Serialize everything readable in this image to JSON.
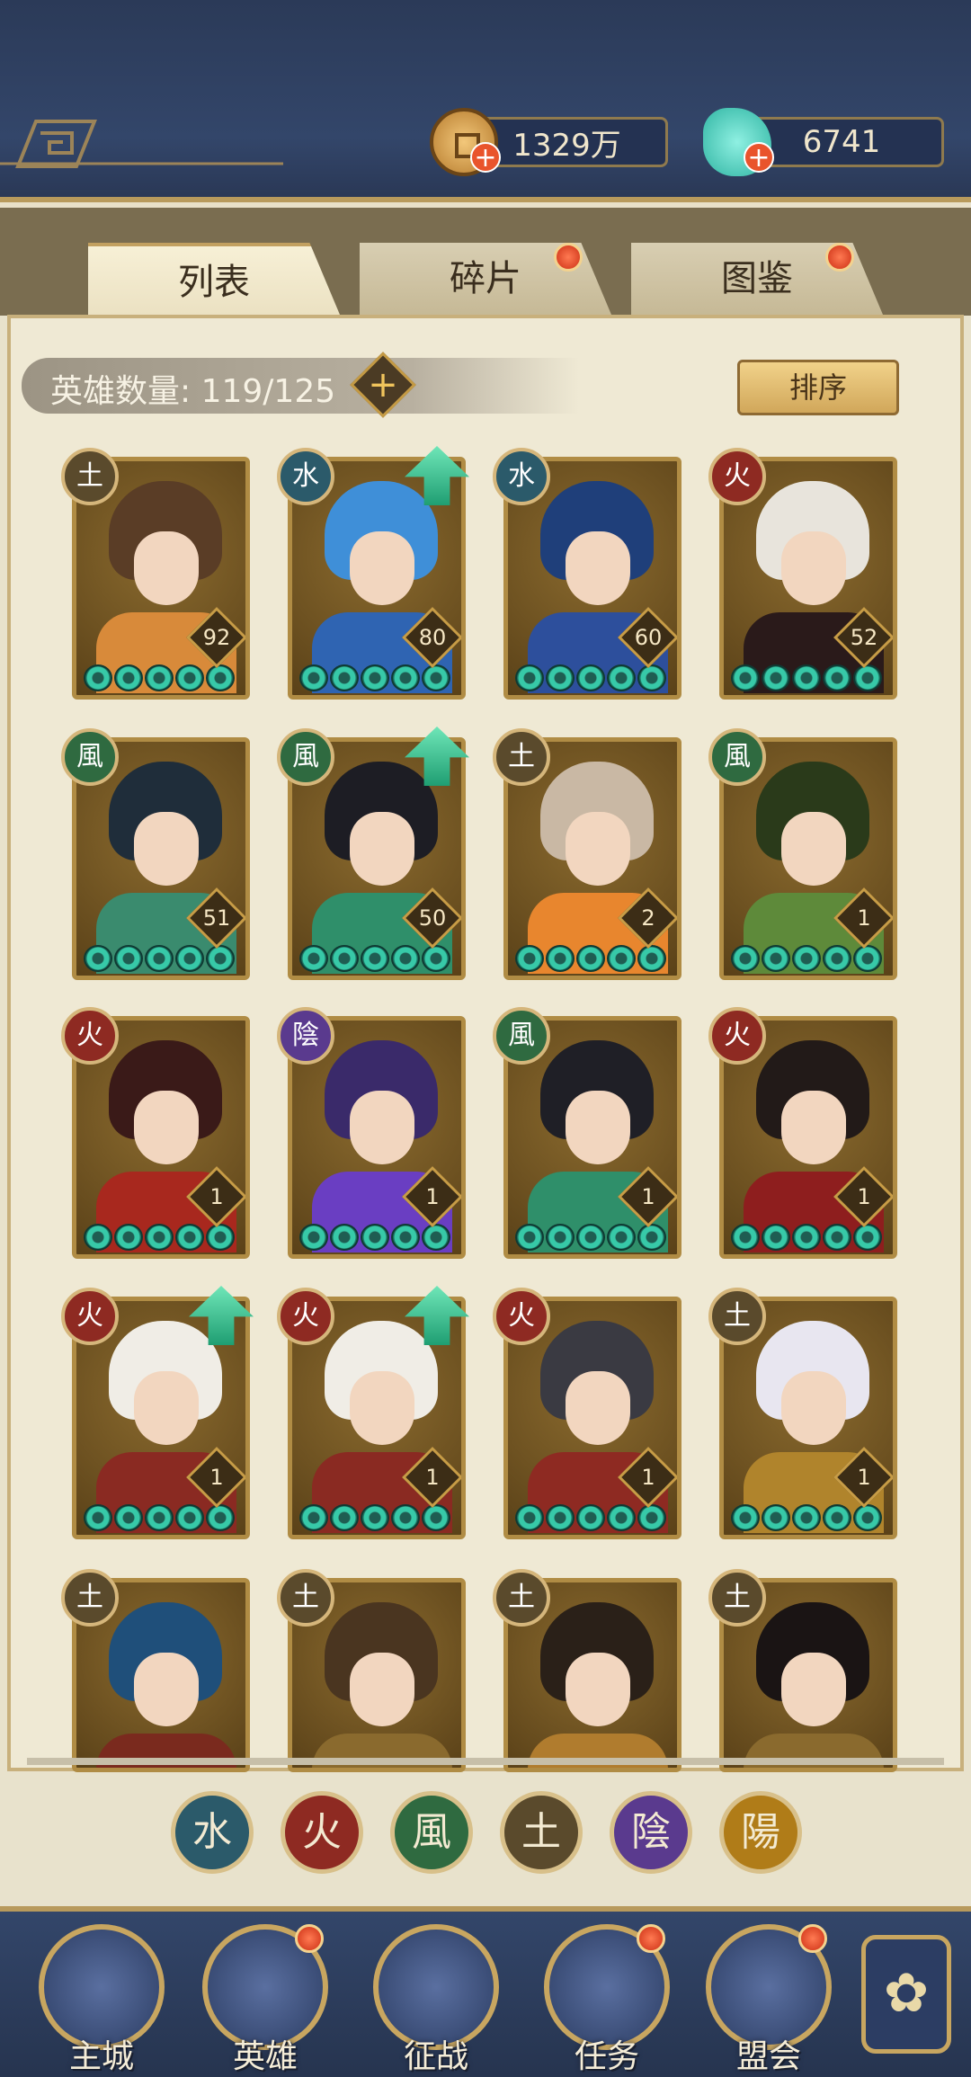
{
  "currency": {
    "coins": "1329万",
    "jade": "6741",
    "coin_icon": "copper-coin-icon",
    "jade_icon": "jade-shell-icon"
  },
  "tabs": [
    {
      "label": "列表",
      "active": true,
      "notify": false
    },
    {
      "label": "碎片",
      "active": false,
      "notify": true
    },
    {
      "label": "图鉴",
      "active": false,
      "notify": true
    }
  ],
  "hero_count": "英雄数量: 119/125",
  "sort_label": "排序",
  "heroes": [
    {
      "element": "土",
      "level": "92",
      "upgrade": false
    },
    {
      "element": "水",
      "level": "80",
      "upgrade": true
    },
    {
      "element": "水",
      "level": "60",
      "upgrade": false
    },
    {
      "element": "火",
      "level": "52",
      "upgrade": false
    },
    {
      "element": "風",
      "level": "51",
      "upgrade": false
    },
    {
      "element": "風",
      "level": "50",
      "upgrade": true
    },
    {
      "element": "土",
      "level": "2",
      "upgrade": false
    },
    {
      "element": "風",
      "level": "1",
      "upgrade": false
    },
    {
      "element": "火",
      "level": "1",
      "upgrade": false
    },
    {
      "element": "陰",
      "level": "1",
      "upgrade": false
    },
    {
      "element": "風",
      "level": "1",
      "upgrade": false
    },
    {
      "element": "火",
      "level": "1",
      "upgrade": false
    },
    {
      "element": "火",
      "level": "1",
      "upgrade": true
    },
    {
      "element": "火",
      "level": "1",
      "upgrade": true
    },
    {
      "element": "火",
      "level": "1",
      "upgrade": false
    },
    {
      "element": "土",
      "level": "1",
      "upgrade": false
    },
    {
      "element": "土",
      "level": "",
      "upgrade": false
    },
    {
      "element": "土",
      "level": "",
      "upgrade": false
    },
    {
      "element": "土",
      "level": "",
      "upgrade": false
    },
    {
      "element": "土",
      "level": "",
      "upgrade": false
    }
  ],
  "filters": [
    "水",
    "火",
    "風",
    "土",
    "陰",
    "陽"
  ],
  "nav": [
    {
      "label": "主城",
      "notify": false
    },
    {
      "label": "英雄",
      "notify": true
    },
    {
      "label": "征战",
      "notify": false
    },
    {
      "label": "任务",
      "notify": true
    },
    {
      "label": "盟会",
      "notify": true
    }
  ],
  "colors": {
    "accent_gold": "#b08c44",
    "notify_red": "#cc2f14",
    "gem_teal": "#37c9a8",
    "upgrade_green": "#1f9e72"
  }
}
